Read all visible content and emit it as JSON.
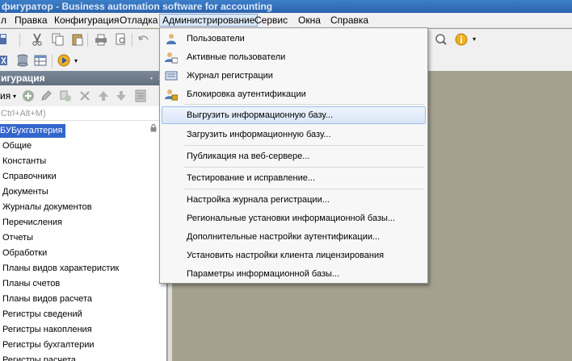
{
  "window": {
    "title": "фигуратор - Business automation software for accounting"
  },
  "menubar": {
    "items": [
      {
        "label": "л"
      },
      {
        "label": "Правка"
      },
      {
        "label": "Конфигурация"
      },
      {
        "label": "Отладка"
      },
      {
        "label": "Администрирование"
      },
      {
        "label": "Сервис"
      },
      {
        "label": "Окна"
      },
      {
        "label": "Справка"
      }
    ]
  },
  "config_panel": {
    "title": "игурация",
    "pin_glyph": "•",
    "close_glyph": "×",
    "actions_label": "ия",
    "search_placeholder": "Ctrl+Alt+M)",
    "tree": [
      {
        "label": "БУБухгалтерия"
      },
      {
        "label": "Общие"
      },
      {
        "label": "Константы"
      },
      {
        "label": "Справочники"
      },
      {
        "label": "Документы"
      },
      {
        "label": "Журналы документов"
      },
      {
        "label": "Перечисления"
      },
      {
        "label": "Отчеты"
      },
      {
        "label": "Обработки"
      },
      {
        "label": "Планы видов характеристик"
      },
      {
        "label": "Планы счетов"
      },
      {
        "label": "Планы видов расчета"
      },
      {
        "label": "Регистры сведений"
      },
      {
        "label": "Регистры накопления"
      },
      {
        "label": "Регистры бухгалтерии"
      },
      {
        "label": "Регистры расчета"
      }
    ]
  },
  "admin_menu": {
    "items": [
      {
        "label": "Пользователи",
        "icon": "users-icon"
      },
      {
        "label": "Активные пользователи",
        "icon": "active-users-icon"
      },
      {
        "label": "Журнал регистрации",
        "icon": "event-log-icon"
      },
      {
        "label": "Блокировка аутентификации",
        "icon": "auth-lock-icon"
      },
      {
        "label": "Выгрузить информационную базу...",
        "highlighted": true
      },
      {
        "label": "Загрузить информационную базу..."
      },
      {
        "label": "Публикация на веб-сервере..."
      },
      {
        "label": "Тестирование и исправление..."
      },
      {
        "label": "Настройка журнала регистрации..."
      },
      {
        "label": "Региональные установки информационной базы..."
      },
      {
        "label": "Дополнительные настройки аутентификации..."
      },
      {
        "label": "Установить настройки клиента лицензирования"
      },
      {
        "label": "Параметры информационной базы..."
      }
    ]
  },
  "colors": {
    "titlebar": "#2b63ad",
    "selection": "#3366cc",
    "menu_highlight": "#d9e6f8",
    "workspace": "#a5a08f"
  }
}
